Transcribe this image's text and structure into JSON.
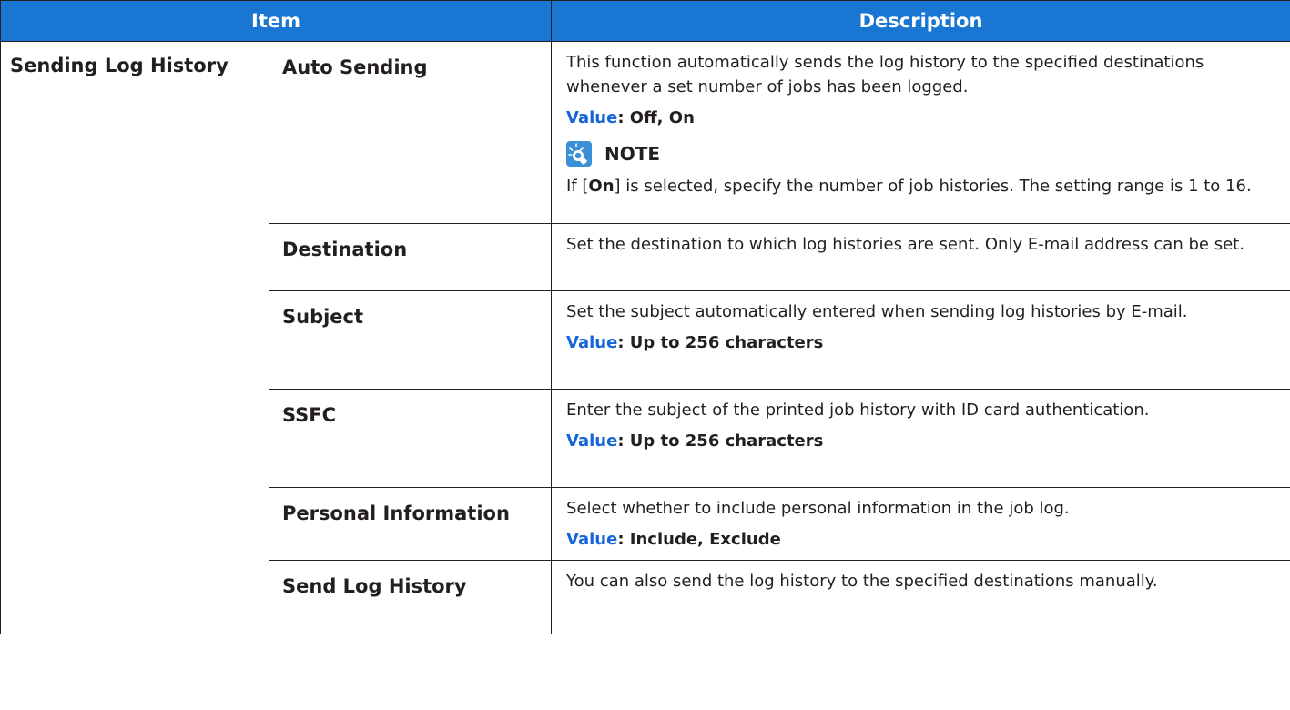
{
  "header": {
    "item": "Item",
    "description": "Description"
  },
  "group": {
    "label": "Sending Log History"
  },
  "rows": [
    {
      "item": "Auto Sending",
      "description": "This function automatically sends the log history to the specified destinations whenever a set number of jobs has been logged.",
      "value_key": "Value",
      "value_text": ": Off, On",
      "note": {
        "heading": "NOTE",
        "icon": "note-bulb-icon",
        "text_before": "If [",
        "text_bold": "On",
        "text_after": "] is selected, specify the number of job histories. The setting range is 1 to 16."
      }
    },
    {
      "item": "Destination",
      "description": "Set the destination to which log histories are sent. Only E-mail address can be set."
    },
    {
      "item": "Subject",
      "description": "Set the subject automatically entered when sending log histories by E-mail.",
      "value_key": "Value",
      "value_text": ": Up to 256 characters"
    },
    {
      "item": "SSFC",
      "description": "Enter the subject of the printed job history with ID card authentication.",
      "value_key": "Value",
      "value_text": ": Up to 256 characters"
    },
    {
      "item": "Personal Information",
      "description": "Select whether to include personal information in the job log.",
      "value_key": "Value",
      "value_text": ": Include, Exclude"
    },
    {
      "item": "Send Log History",
      "description": "You can also send the log history to the specified destinations manually."
    }
  ],
  "colors": {
    "header_bg": "#1976d2",
    "value_accent": "#1565d8",
    "icon_bg": "#3b8fd6"
  }
}
